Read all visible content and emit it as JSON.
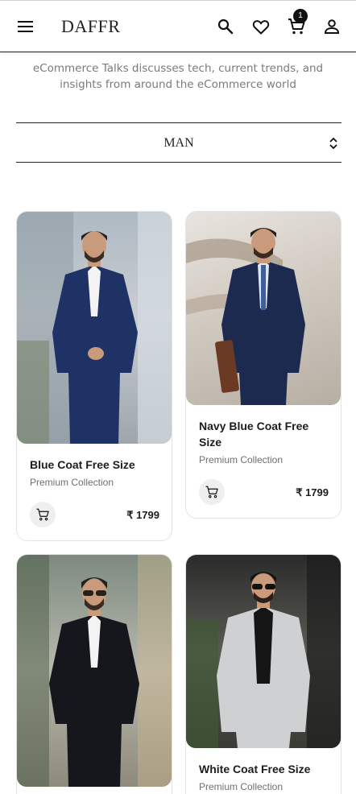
{
  "header": {
    "logo": "DAFFR",
    "cart_count": "1",
    "icons": [
      "menu-icon",
      "search-icon",
      "heart-icon",
      "cart-icon",
      "user-icon"
    ]
  },
  "tagline": "eCommerce Talks discusses tech, current trends, and insights from around the eCommerce world",
  "filter": {
    "selected": "MAN"
  },
  "products": [
    {
      "title": "Blue Coat Free Size",
      "subtitle": "Premium Collection",
      "price": "₹ 1799",
      "suit_color": "#1f3266"
    },
    {
      "title": "Navy Blue Coat Free Size",
      "subtitle": "Premium Collection",
      "price": "₹ 1799",
      "suit_color": "#1c2a4f"
    },
    {
      "title": "",
      "subtitle": "",
      "price": "",
      "suit_color": "#15171c"
    },
    {
      "title": "White Coat Free Size",
      "subtitle": "Premium Collection",
      "price": "",
      "suit_color": "#cfd0d2"
    }
  ],
  "colors": {
    "accent": "#111111",
    "muted": "#7a7a7a",
    "border": "#e4e4e4"
  }
}
